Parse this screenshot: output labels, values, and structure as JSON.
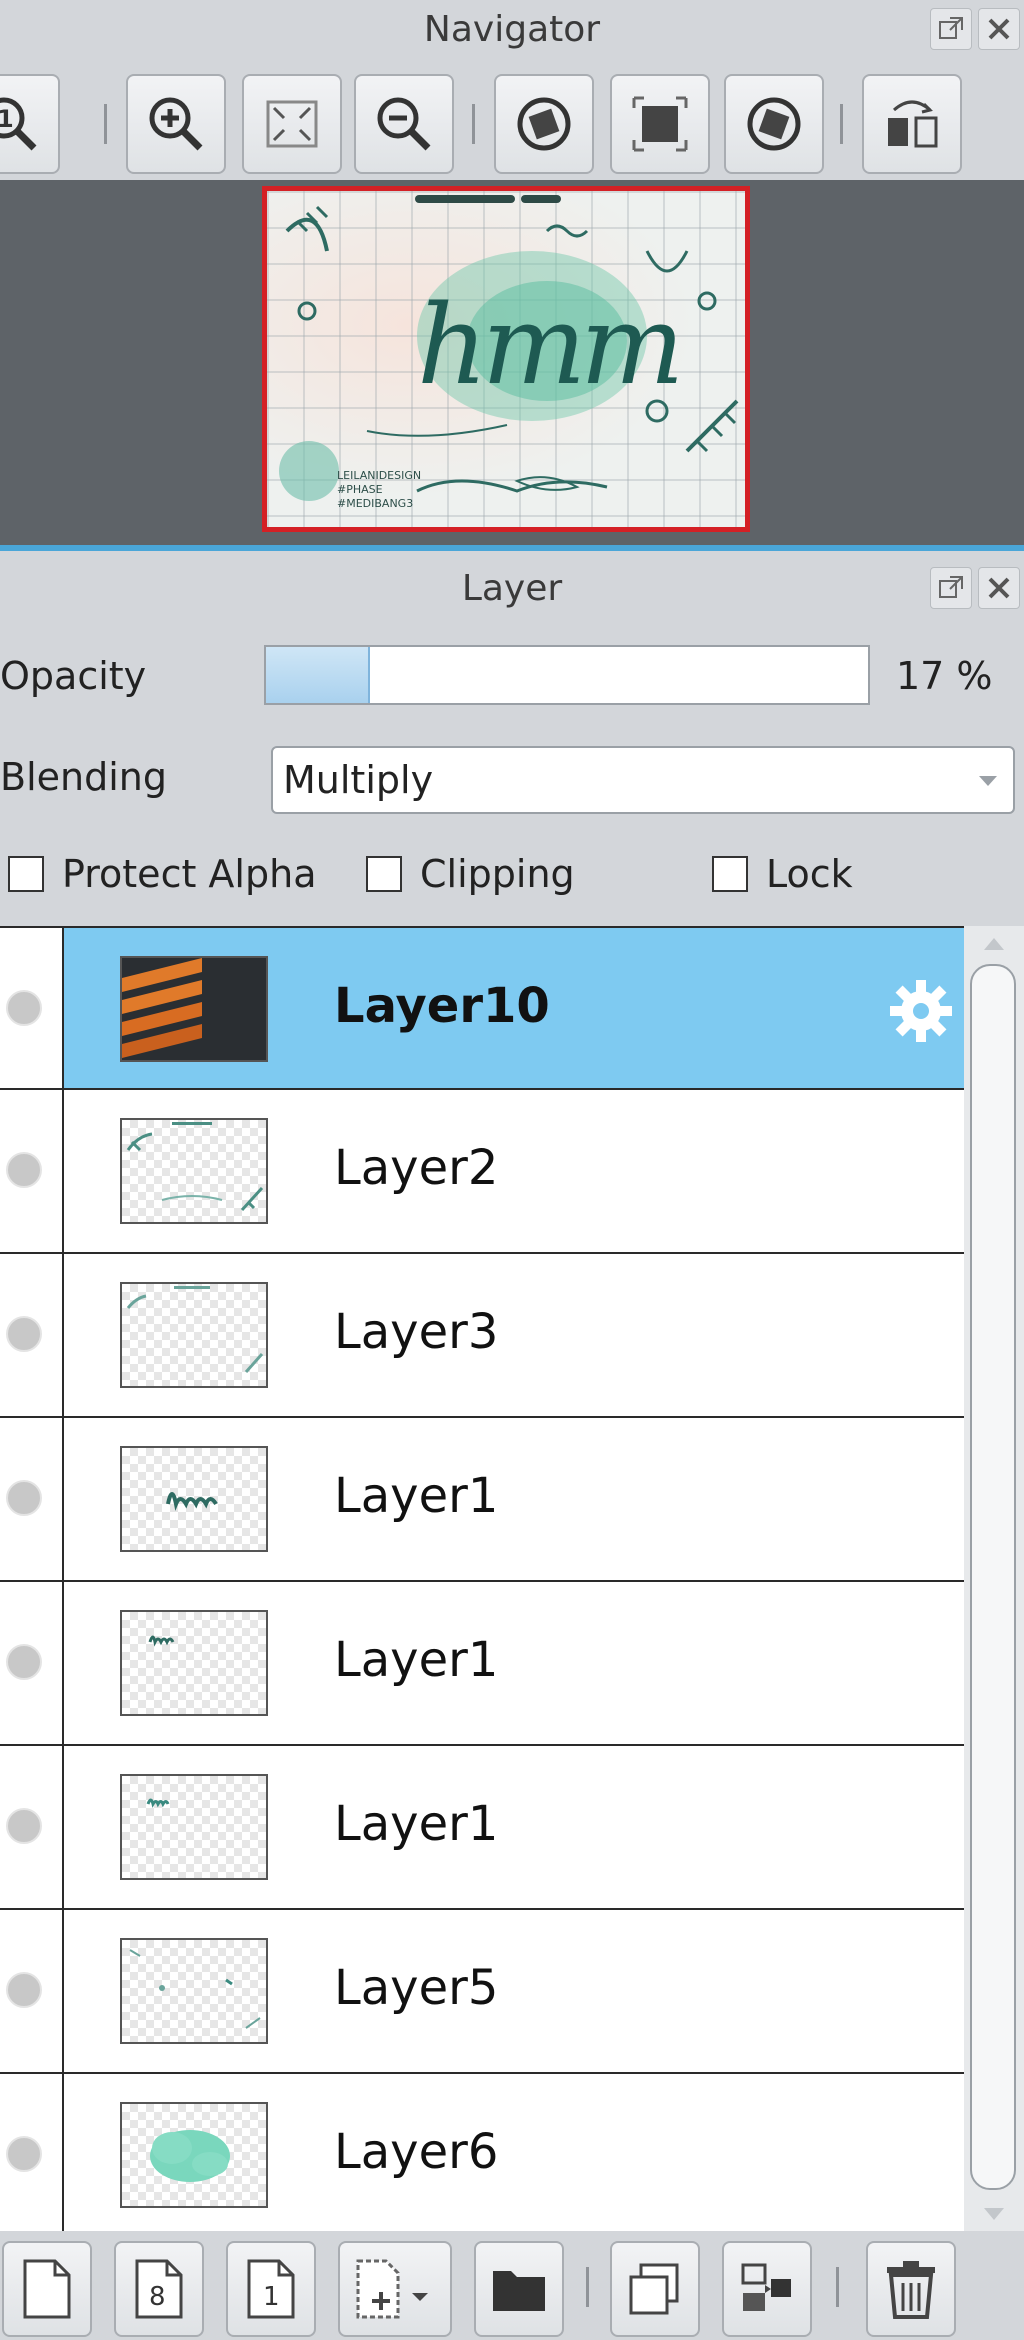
{
  "navigator": {
    "title": "Navigator",
    "toolbar": [
      {
        "icon": "actual-size-icon"
      },
      {
        "icon": "zoom-in-icon"
      },
      {
        "icon": "fit-to-window-icon"
      },
      {
        "icon": "zoom-out-icon"
      },
      {
        "icon": "rotate-left-icon"
      },
      {
        "icon": "reset-view-icon"
      },
      {
        "icon": "rotate-right-icon"
      },
      {
        "icon": "flip-horizontal-icon"
      }
    ],
    "preview": {
      "canvas_text": "hmm",
      "small_text": [
        "LEILANIDESIGN",
        "#PHASE",
        "#MEDIBANG3"
      ]
    }
  },
  "layer_panel": {
    "title": "Layer",
    "opacity": {
      "label": "Opacity",
      "value_text": "17 %",
      "fraction": 0.17
    },
    "blending": {
      "label": "Blending",
      "selected": "Multiply"
    },
    "checkboxes": [
      {
        "label": "Protect Alpha",
        "checked": false
      },
      {
        "label": "Clipping",
        "checked": false
      },
      {
        "label": "Lock",
        "checked": false
      }
    ],
    "layers": [
      {
        "name": "Layer10",
        "selected": true,
        "thumb": "orange-stripes"
      },
      {
        "name": "Layer2",
        "selected": false,
        "thumb": "frame-leaves"
      },
      {
        "name": "Layer3",
        "selected": false,
        "thumb": "frame-leaves-light"
      },
      {
        "name": "Layer1",
        "selected": false,
        "thumb": "hmm-large"
      },
      {
        "name": "Layer1",
        "selected": false,
        "thumb": "hmm-small"
      },
      {
        "name": "Layer1",
        "selected": false,
        "thumb": "hmm-small"
      },
      {
        "name": "Layer5",
        "selected": false,
        "thumb": "scribbles"
      },
      {
        "name": "Layer6",
        "selected": false,
        "thumb": "green-blob"
      }
    ],
    "bottom_toolbar": [
      {
        "icon": "new-layer-icon",
        "text": ""
      },
      {
        "icon": "new-8bit-layer-icon",
        "text": "8"
      },
      {
        "icon": "new-1bit-layer-icon",
        "text": "1"
      },
      {
        "icon": "add-layer-menu-icon",
        "text": ""
      },
      {
        "icon": "new-folder-icon",
        "text": ""
      },
      {
        "icon": "duplicate-layer-icon",
        "text": ""
      },
      {
        "icon": "merge-down-icon",
        "text": ""
      },
      {
        "icon": "delete-layer-icon",
        "text": ""
      }
    ]
  },
  "colors": {
    "selection": "#7ecaf1",
    "panel_bg": "#d3d6da",
    "navigator_frame": "#d42025"
  }
}
